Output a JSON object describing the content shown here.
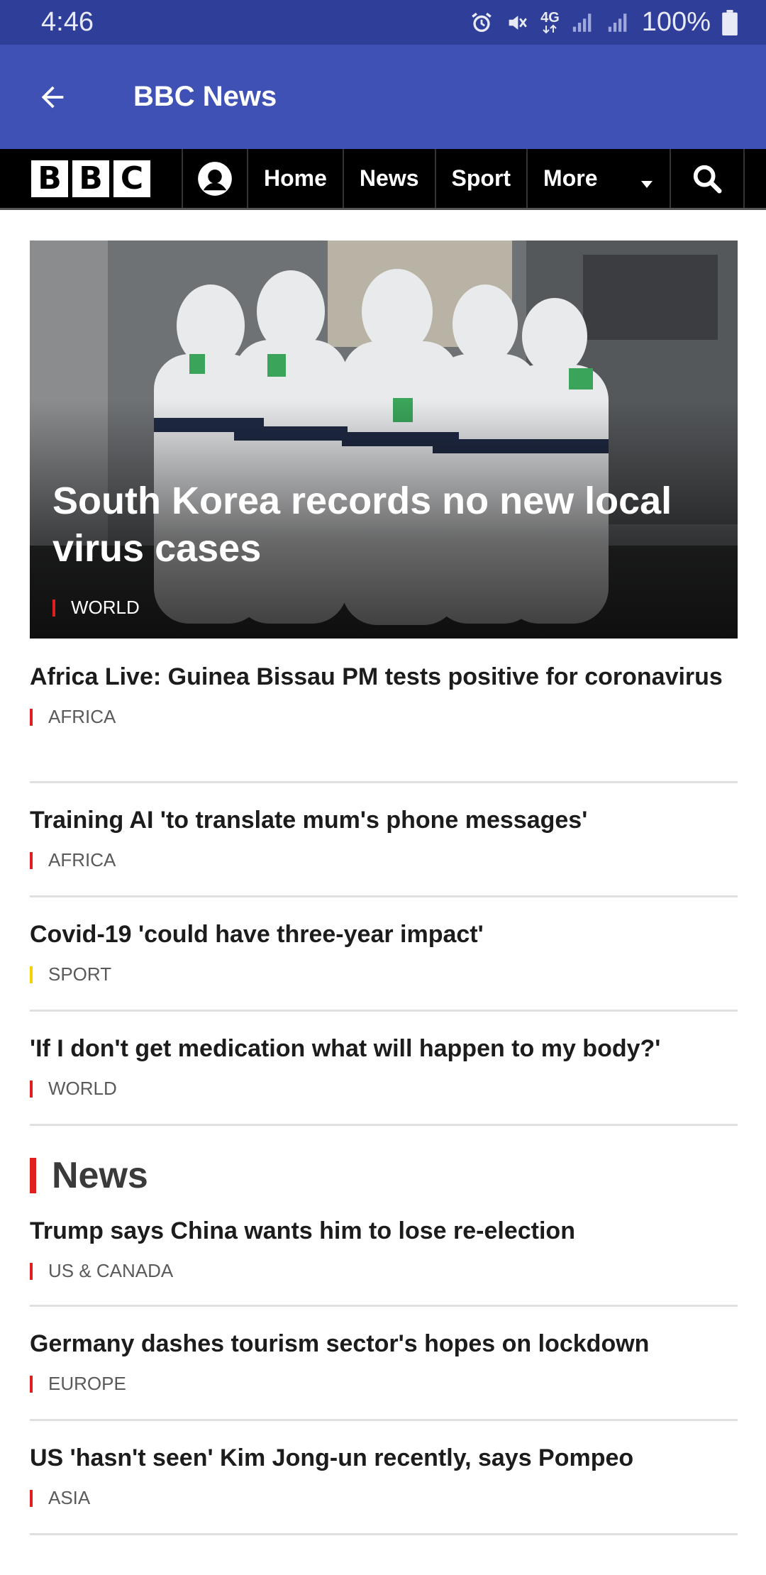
{
  "status_bar": {
    "time": "4:46",
    "network": "4G",
    "battery": "100%"
  },
  "app_bar": {
    "title": "BBC News"
  },
  "bbc_nav": {
    "logo": [
      "B",
      "B",
      "C"
    ],
    "items": [
      "Home",
      "News",
      "Sport",
      "More"
    ]
  },
  "hero": {
    "title": "South Korea records no new local virus cases",
    "tag": "WORLD",
    "tag_color": "#e01f1f"
  },
  "top_stories": [
    {
      "title": "Africa Live: Guinea Bissau PM tests positive for coronavirus",
      "tag": "AFRICA",
      "tag_color": "#e01f1f"
    },
    {
      "title": "Training AI 'to translate mum's phone messages'",
      "tag": "AFRICA",
      "tag_color": "#e01f1f"
    },
    {
      "title": "Covid-19 'could have three-year impact'",
      "tag": "SPORT",
      "tag_color": "#f5d200"
    },
    {
      "title": "'If I don't get medication what will happen to my body?'",
      "tag": "WORLD",
      "tag_color": "#e01f1f"
    }
  ],
  "news_section": {
    "title": "News",
    "stories": [
      {
        "title": "Trump says China wants him to lose re-election",
        "tag": "US & CANADA",
        "tag_color": "#e01f1f"
      },
      {
        "title": "Germany dashes tourism sector's hopes on lockdown",
        "tag": "EUROPE",
        "tag_color": "#e01f1f"
      },
      {
        "title": "US 'hasn't seen' Kim Jong-un recently, says Pompeo",
        "tag": "ASIA",
        "tag_color": "#e01f1f"
      }
    ]
  },
  "colors": {
    "status_bar": "#2f3e98",
    "app_bar": "#3f51b5",
    "nav_bg": "#000000",
    "accent_red": "#e01f1f",
    "accent_yellow": "#f5d200"
  }
}
